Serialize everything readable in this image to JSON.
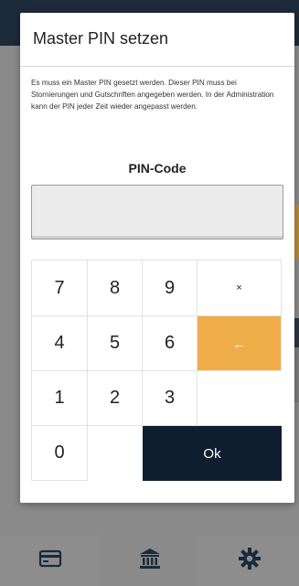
{
  "dialog": {
    "title": "Master PIN setzen",
    "message": "Es muss ein Master PIN gesetzt werden. Dieser PIN muss bei Stornierungen und Gutschriften angegeben werden. In der Administration kann der PIN jeder Zeit wieder angepasst werden.",
    "pin_label": "PIN-Code",
    "pin_value": ""
  },
  "keypad": {
    "k7": "7",
    "k8": "8",
    "k9": "9",
    "clear": "×",
    "k4": "4",
    "k5": "5",
    "k6": "6",
    "backspace": "←",
    "k1": "1",
    "k2": "2",
    "k3": "3",
    "k0": "0",
    "ok": "Ok"
  },
  "colors": {
    "accent_orange": "#efad4a",
    "ok_navy": "#0e1e2f"
  },
  "bottom_nav": {
    "items": [
      "card-icon",
      "bank-icon",
      "gear-icon"
    ]
  }
}
